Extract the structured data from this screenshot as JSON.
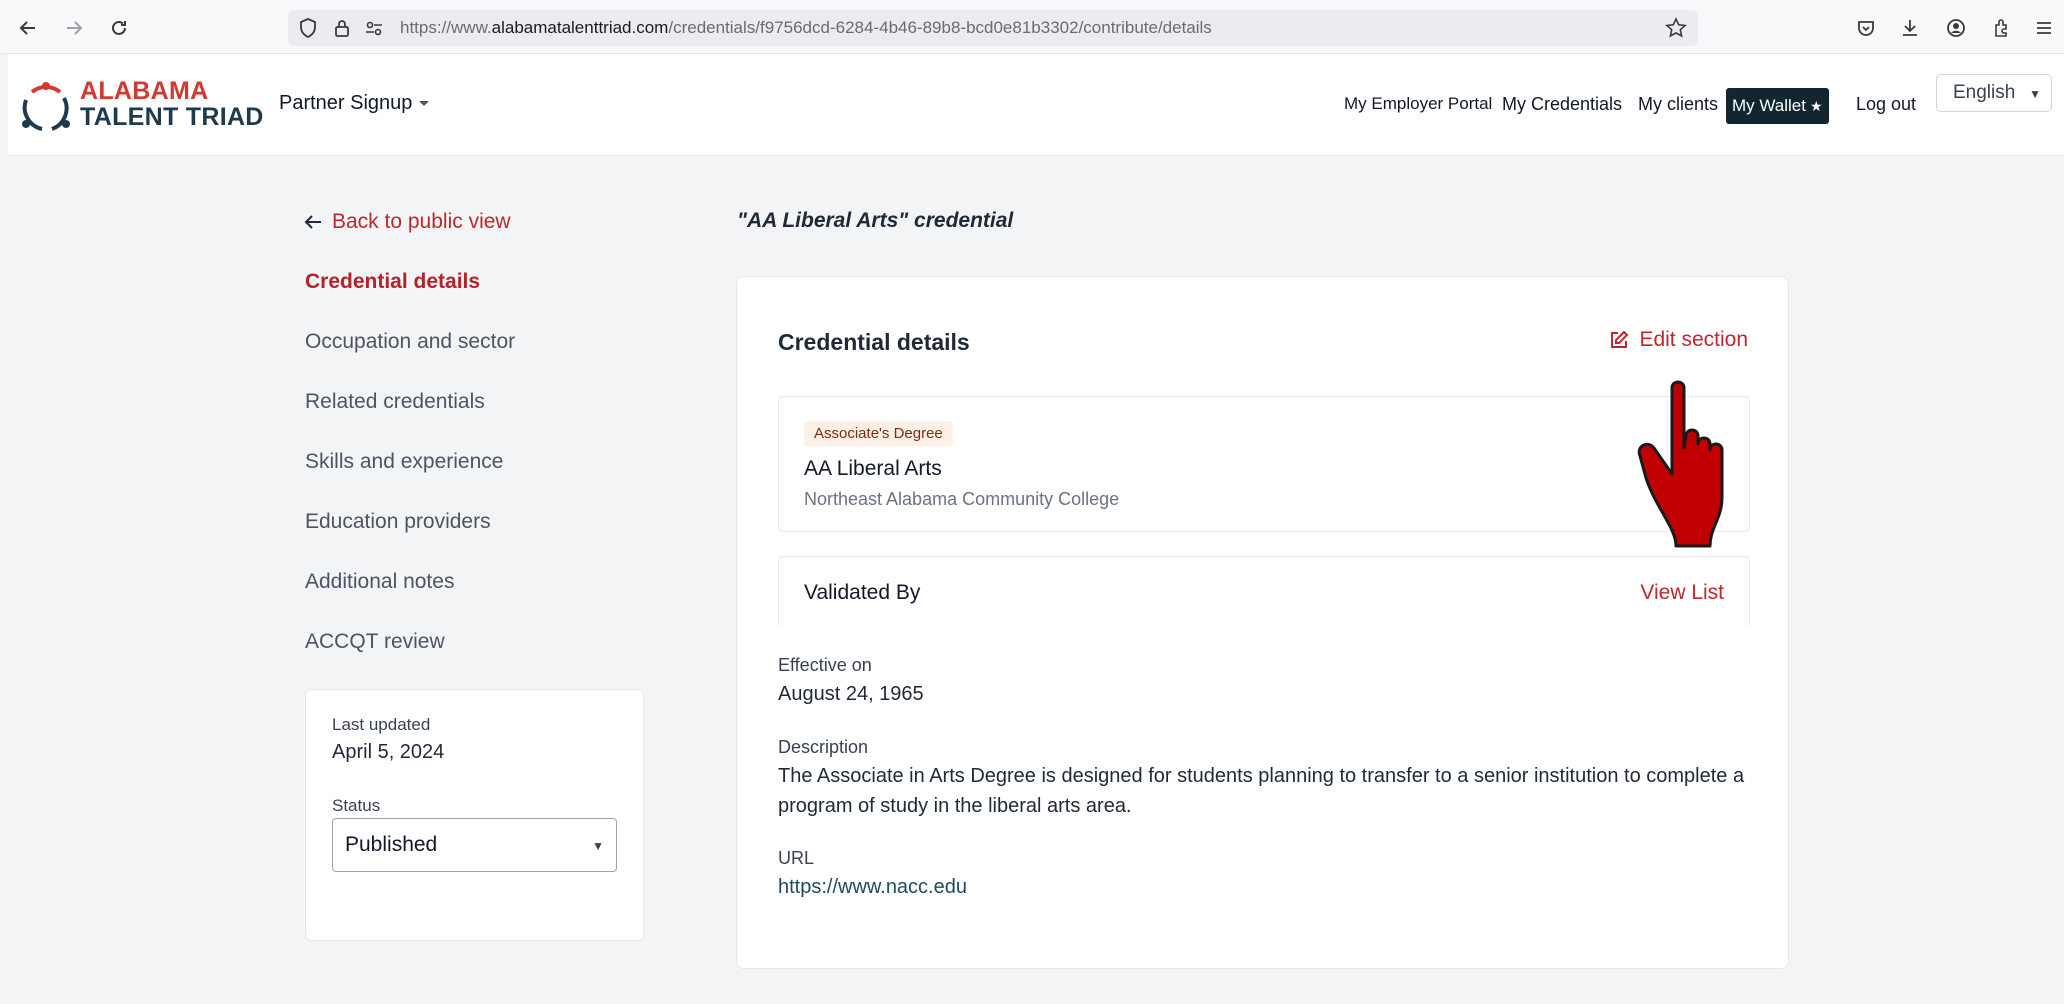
{
  "browser": {
    "url_prefix": "https://www.",
    "url_domain": "alabamatalenttriad.com",
    "url_path": "/credentials/f9756dcd-6284-4b46-89b8-bcd0e81b3302/contribute/details"
  },
  "header": {
    "logo_line1": "ALABAMA",
    "logo_line2": "TALENT TRIAD",
    "partner_signup": "Partner Signup",
    "nav": {
      "employer_portal": "My Employer Portal",
      "credentials": "My Credentials",
      "clients": "My clients",
      "wallet": "My Wallet",
      "logout": "Log out"
    },
    "language": "English"
  },
  "sidebar": {
    "back_link": "Back to public view",
    "items": [
      {
        "label": "Credential details"
      },
      {
        "label": "Occupation and sector"
      },
      {
        "label": "Related credentials"
      },
      {
        "label": "Skills and experience"
      },
      {
        "label": "Education providers"
      },
      {
        "label": "Additional notes"
      },
      {
        "label": "ACCQT review"
      }
    ],
    "last_updated_label": "Last updated",
    "last_updated_value": "April 5, 2024",
    "status_label": "Status",
    "status_value": "Published"
  },
  "main": {
    "heading": "\"AA Liberal Arts\" credential",
    "card_title": "Credential details",
    "edit_section": "Edit section",
    "credential": {
      "badge": "Associate's Degree",
      "name": "AA Liberal Arts",
      "college": "Northeast Alabama Community College"
    },
    "validated_by": "Validated By",
    "view_list": "View List",
    "effective_label": "Effective on",
    "effective_value": "August 24, 1965",
    "description_label": "Description",
    "description_value": "The Associate in Arts Degree is designed for students planning to transfer to a senior institution to complete a program of study in the liberal arts area.",
    "url_label": "URL",
    "url_value": "https://www.nacc.edu"
  },
  "colors": {
    "accent_red": "#c0262d",
    "wallet_bg": "#12262f",
    "badge_bg": "#fdf0e6"
  }
}
